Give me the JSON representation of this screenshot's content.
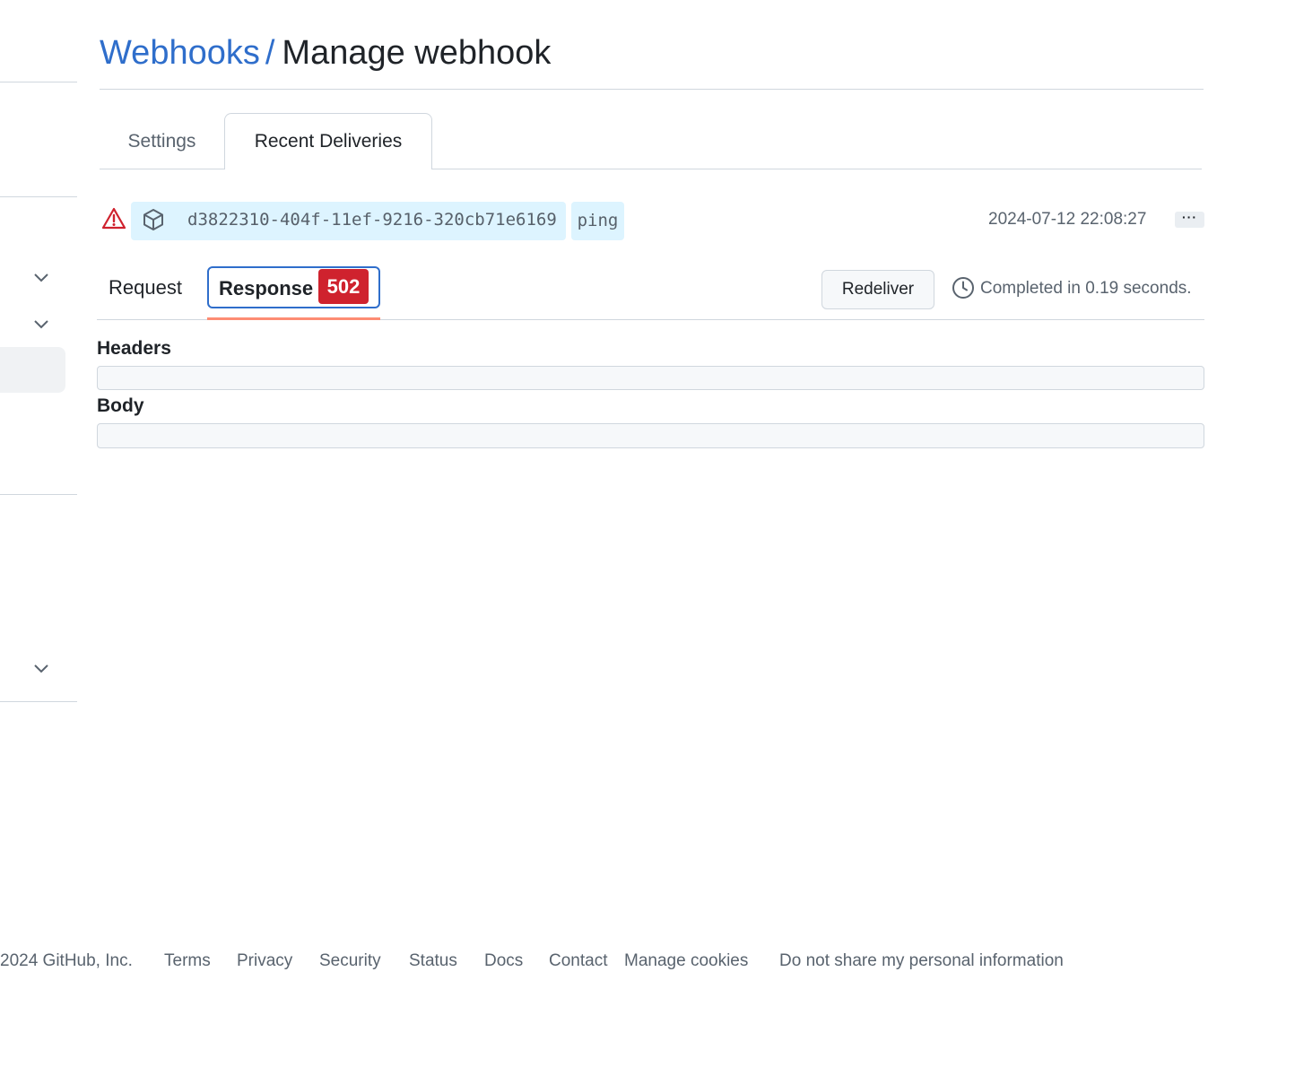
{
  "header": {
    "breadcrumb": "Webhooks",
    "separator": "/",
    "title": "Manage webhook"
  },
  "tabs": {
    "settings": "Settings",
    "recent_deliveries": "Recent Deliveries"
  },
  "delivery": {
    "guid": "d3822310-404f-11ef-9216-320cb71e6169",
    "event": "ping",
    "timestamp": "2024-07-12 22:08:27",
    "more_label": "···"
  },
  "detail_tabs": {
    "request": "Request",
    "response": "Response",
    "status_code": "502"
  },
  "actions": {
    "redeliver": "Redeliver",
    "completed": "Completed in 0.19 seconds."
  },
  "sections": {
    "headers": "Headers",
    "body": "Body"
  },
  "footer": {
    "copyright": "2024 GitHub, Inc.",
    "links": [
      "Terms",
      "Privacy",
      "Security",
      "Status",
      "Docs",
      "Contact",
      "Manage cookies",
      "Do not share my personal information"
    ]
  },
  "colors": {
    "link": "#2f6ecb",
    "danger": "#cf222e",
    "chip": "#ddf4ff",
    "tab_underline": "#fd8c73"
  },
  "icons": [
    "alert-icon",
    "package-icon",
    "clock-icon",
    "chevron-down-icon"
  ]
}
